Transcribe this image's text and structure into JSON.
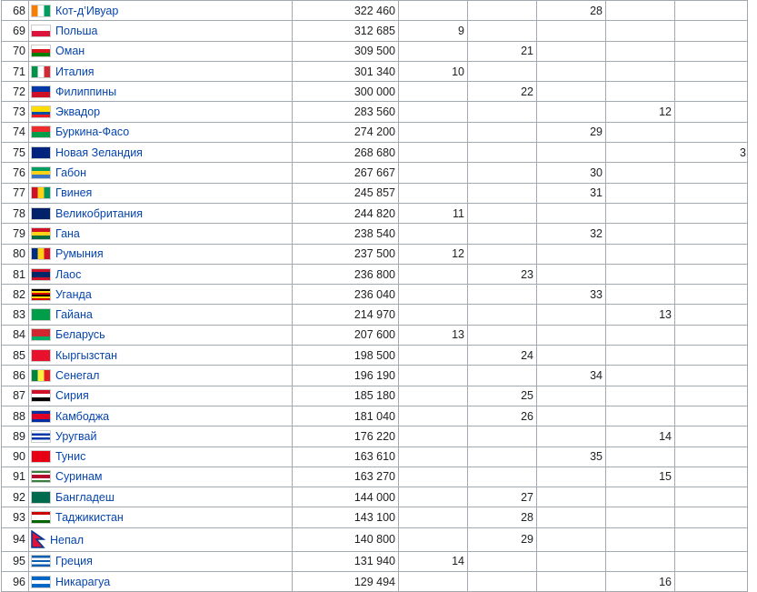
{
  "rows": [
    {
      "rank": "68",
      "country": "Кот-д’Ивуар",
      "area": "322 460",
      "c1": "",
      "c2": "",
      "c3": "28",
      "c4": "",
      "c5": "",
      "flag": "flag-cote-divoire",
      "fg": [
        "#f77f00",
        "#ffffff",
        "#009e60"
      ],
      "dir": "v"
    },
    {
      "rank": "69",
      "country": "Польша",
      "area": "312 685",
      "c1": "9",
      "c2": "",
      "c3": "",
      "c4": "",
      "c5": "",
      "flag": "flag-poland",
      "fg": [
        "#ffffff",
        "#dc143c"
      ],
      "dir": "h"
    },
    {
      "rank": "70",
      "country": "Оман",
      "area": "309 500",
      "c1": "",
      "c2": "21",
      "c3": "",
      "c4": "",
      "c5": "",
      "flag": "flag-oman",
      "fg": [
        "#ffffff",
        "#db161b",
        "#008000"
      ],
      "dir": "h"
    },
    {
      "rank": "71",
      "country": "Италия",
      "area": "301 340",
      "c1": "10",
      "c2": "",
      "c3": "",
      "c4": "",
      "c5": "",
      "flag": "flag-italy",
      "fg": [
        "#009246",
        "#ffffff",
        "#ce2b37"
      ],
      "dir": "v"
    },
    {
      "rank": "72",
      "country": "Филиппины",
      "area": "300 000",
      "c1": "",
      "c2": "22",
      "c3": "",
      "c4": "",
      "c5": "",
      "flag": "flag-philippines",
      "fg": [
        "#0038a8",
        "#ce1126"
      ],
      "dir": "h"
    },
    {
      "rank": "73",
      "country": "Эквадор",
      "area": "283 560",
      "c1": "",
      "c2": "",
      "c3": "",
      "c4": "12",
      "c5": "",
      "flag": "flag-ecuador",
      "fg": [
        "#ffdd00",
        "#ffdd00",
        "#034ea2",
        "#ed1c24"
      ],
      "dir": "h"
    },
    {
      "rank": "74",
      "country": "Буркина-Фасо",
      "area": "274 200",
      "c1": "",
      "c2": "",
      "c3": "29",
      "c4": "",
      "c5": "",
      "flag": "flag-burkina-faso",
      "fg": [
        "#ef2b2d",
        "#009e49"
      ],
      "dir": "h"
    },
    {
      "rank": "75",
      "country": "Новая Зеландия",
      "area": "268 680",
      "c1": "",
      "c2": "",
      "c3": "",
      "c4": "",
      "c5": "3",
      "flag": "flag-new-zealand",
      "fg": [
        "#00247d"
      ],
      "dir": "h"
    },
    {
      "rank": "76",
      "country": "Габон",
      "area": "267 667",
      "c1": "",
      "c2": "",
      "c3": "30",
      "c4": "",
      "c5": "",
      "flag": "flag-gabon",
      "fg": [
        "#009e60",
        "#fcd116",
        "#3a75c4"
      ],
      "dir": "h"
    },
    {
      "rank": "77",
      "country": "Гвинея",
      "area": "245 857",
      "c1": "",
      "c2": "",
      "c3": "31",
      "c4": "",
      "c5": "",
      "flag": "flag-guinea",
      "fg": [
        "#ce1126",
        "#fcd116",
        "#009460"
      ],
      "dir": "v"
    },
    {
      "rank": "78",
      "country": "Великобритания",
      "area": "244 820",
      "c1": "11",
      "c2": "",
      "c3": "",
      "c4": "",
      "c5": "",
      "flag": "flag-united-kingdom",
      "fg": [
        "#012169"
      ],
      "dir": "h"
    },
    {
      "rank": "79",
      "country": "Гана",
      "area": "238 540",
      "c1": "",
      "c2": "",
      "c3": "32",
      "c4": "",
      "c5": "",
      "flag": "flag-ghana",
      "fg": [
        "#ce1126",
        "#fcd116",
        "#006b3f"
      ],
      "dir": "h"
    },
    {
      "rank": "80",
      "country": "Румыния",
      "area": "237 500",
      "c1": "12",
      "c2": "",
      "c3": "",
      "c4": "",
      "c5": "",
      "flag": "flag-romania",
      "fg": [
        "#002b7f",
        "#fcd116",
        "#ce1126"
      ],
      "dir": "v"
    },
    {
      "rank": "81",
      "country": "Лаос",
      "area": "236 800",
      "c1": "",
      "c2": "23",
      "c3": "",
      "c4": "",
      "c5": "",
      "flag": "flag-laos",
      "fg": [
        "#ce1126",
        "#002868",
        "#002868",
        "#ce1126"
      ],
      "dir": "h"
    },
    {
      "rank": "82",
      "country": "Уганда",
      "area": "236 040",
      "c1": "",
      "c2": "",
      "c3": "33",
      "c4": "",
      "c5": "",
      "flag": "flag-uganda",
      "fg": [
        "#000000",
        "#fcdc04",
        "#d90000",
        "#000000",
        "#fcdc04",
        "#d90000"
      ],
      "dir": "h"
    },
    {
      "rank": "83",
      "country": "Гайана",
      "area": "214 970",
      "c1": "",
      "c2": "",
      "c3": "",
      "c4": "13",
      "c5": "",
      "flag": "flag-guyana",
      "fg": [
        "#009e49"
      ],
      "dir": "h"
    },
    {
      "rank": "84",
      "country": "Беларусь",
      "area": "207 600",
      "c1": "13",
      "c2": "",
      "c3": "",
      "c4": "",
      "c5": "",
      "flag": "flag-belarus",
      "fg": [
        "#d22730",
        "#d22730",
        "#00af66"
      ],
      "dir": "h"
    },
    {
      "rank": "85",
      "country": "Кыргызстан",
      "area": "198 500",
      "c1": "",
      "c2": "24",
      "c3": "",
      "c4": "",
      "c5": "",
      "flag": "flag-kyrgyzstan",
      "fg": [
        "#e8112d"
      ],
      "dir": "h"
    },
    {
      "rank": "86",
      "country": "Сенегал",
      "area": "196 190",
      "c1": "",
      "c2": "",
      "c3": "34",
      "c4": "",
      "c5": "",
      "flag": "flag-senegal",
      "fg": [
        "#00853f",
        "#fdef42",
        "#e31b23"
      ],
      "dir": "v"
    },
    {
      "rank": "87",
      "country": "Сирия",
      "area": "185 180",
      "c1": "",
      "c2": "25",
      "c3": "",
      "c4": "",
      "c5": "",
      "flag": "flag-syria",
      "fg": [
        "#ce1126",
        "#ffffff",
        "#000000"
      ],
      "dir": "h"
    },
    {
      "rank": "88",
      "country": "Камбоджа",
      "area": "181 040",
      "c1": "",
      "c2": "26",
      "c3": "",
      "c4": "",
      "c5": "",
      "flag": "flag-cambodia",
      "fg": [
        "#032ea1",
        "#e00025",
        "#e00025",
        "#032ea1"
      ],
      "dir": "h"
    },
    {
      "rank": "89",
      "country": "Уругвай",
      "area": "176 220",
      "c1": "",
      "c2": "",
      "c3": "",
      "c4": "14",
      "c5": "",
      "flag": "flag-uruguay",
      "fg": [
        "#ffffff",
        "#0038a8",
        "#ffffff",
        "#0038a8",
        "#ffffff"
      ],
      "dir": "h"
    },
    {
      "rank": "90",
      "country": "Тунис",
      "area": "163 610",
      "c1": "",
      "c2": "",
      "c3": "35",
      "c4": "",
      "c5": "",
      "flag": "flag-tunisia",
      "fg": [
        "#e70013"
      ],
      "dir": "h"
    },
    {
      "rank": "91",
      "country": "Суринам",
      "area": "163 270",
      "c1": "",
      "c2": "",
      "c3": "",
      "c4": "15",
      "c5": "",
      "flag": "flag-suriname",
      "fg": [
        "#377e3f",
        "#ffffff",
        "#b40a2d",
        "#b40a2d",
        "#ffffff",
        "#377e3f"
      ],
      "dir": "h"
    },
    {
      "rank": "92",
      "country": "Бангладеш",
      "area": "144 000",
      "c1": "",
      "c2": "27",
      "c3": "",
      "c4": "",
      "c5": "",
      "flag": "flag-bangladesh",
      "fg": [
        "#006a4e"
      ],
      "dir": "h"
    },
    {
      "rank": "93",
      "country": "Таджикистан",
      "area": "143 100",
      "c1": "",
      "c2": "28",
      "c3": "",
      "c4": "",
      "c5": "",
      "flag": "flag-tajikistan",
      "fg": [
        "#cc0000",
        "#ffffff",
        "#ffffff",
        "#006600"
      ],
      "dir": "h"
    },
    {
      "rank": "94",
      "country": "Непал",
      "area": "140 800",
      "c1": "",
      "c2": "29",
      "c3": "",
      "c4": "",
      "c5": "",
      "flag": "flag-nepal",
      "fg": [
        "#dc143c"
      ],
      "dir": "h"
    },
    {
      "rank": "95",
      "country": "Греция",
      "area": "131 940",
      "c1": "14",
      "c2": "",
      "c3": "",
      "c4": "",
      "c5": "",
      "flag": "flag-greece",
      "fg": [
        "#0d5eaf",
        "#ffffff",
        "#0d5eaf",
        "#ffffff",
        "#0d5eaf"
      ],
      "dir": "h"
    },
    {
      "rank": "96",
      "country": "Никарагуа",
      "area": "129 494",
      "c1": "",
      "c2": "",
      "c3": "",
      "c4": "16",
      "c5": "",
      "flag": "flag-nicaragua",
      "fg": [
        "#0067c6",
        "#ffffff",
        "#0067c6"
      ],
      "dir": "h"
    }
  ]
}
